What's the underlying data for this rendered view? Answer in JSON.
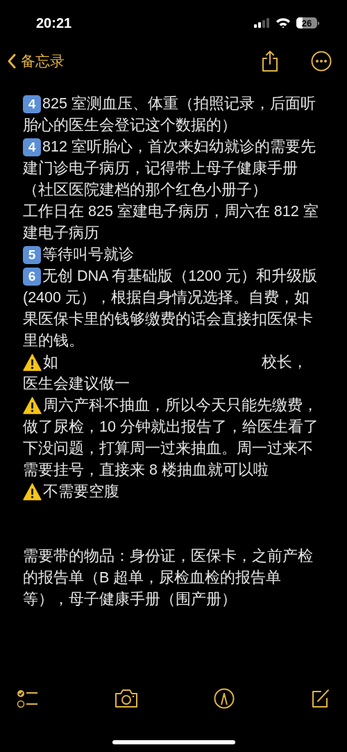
{
  "status_bar": {
    "time": "20:21",
    "battery": "26"
  },
  "nav": {
    "back_label": "备忘录"
  },
  "note": {
    "blocks": [
      {
        "paragraphs": [
          {
            "marker": {
              "kind": "keycap",
              "text": "4"
            },
            "lines": [
              "825 室测血压、体重（拍照记录，后面听",
              "胎心的医生会登记这个数据的）"
            ]
          },
          {
            "marker": {
              "kind": "keycap",
              "text": "4"
            },
            "lines": [
              "812 室听胎心，首次来妇幼就诊的需要先",
              "建门诊电子病历，记得带上母子健康手册",
              "（社区医院建档的那个红色小册子）",
              "工作日在 825 室建电子病历，周六在 812 室",
              "建电子病历"
            ]
          },
          {
            "marker": {
              "kind": "keycap",
              "text": "5"
            },
            "lines": [
              "等待叫号就诊"
            ]
          },
          {
            "marker": {
              "kind": "keycap",
              "text": "6"
            },
            "lines": [
              "无创 DNA 有基础版（1200 元）和升级版",
              "(2400 元），根据自身情况选择。自费，如",
              "果医保卡里的钱够缴费的话会直接扣医保卡",
              "里的钱。"
            ]
          },
          {
            "marker": {
              "kind": "warning"
            },
            "lines": [
              "如",
              "医生会建议做一"
            ],
            "tail": "校长，"
          },
          {
            "marker": {
              "kind": "warning"
            },
            "lines": [
              "周六产科不抽血，所以今天只能先缴费，",
              "做了尿检，10 分钟就出报告了，给医生看了",
              "下没问题，打算周一过来抽血。周一过来不",
              "需要挂号，直接来 8 楼抽血就可以啦"
            ]
          },
          {
            "marker": {
              "kind": "warning"
            },
            "lines": [
              "不需要空腹"
            ]
          }
        ]
      },
      {
        "paragraphs": [
          {
            "lines": [
              "需要带的物品：身份证，医保卡，之前产检",
              "的报告单（B 超单，尿检血检的报告单",
              "等），母子健康手册（围产册）"
            ]
          }
        ]
      }
    ]
  }
}
